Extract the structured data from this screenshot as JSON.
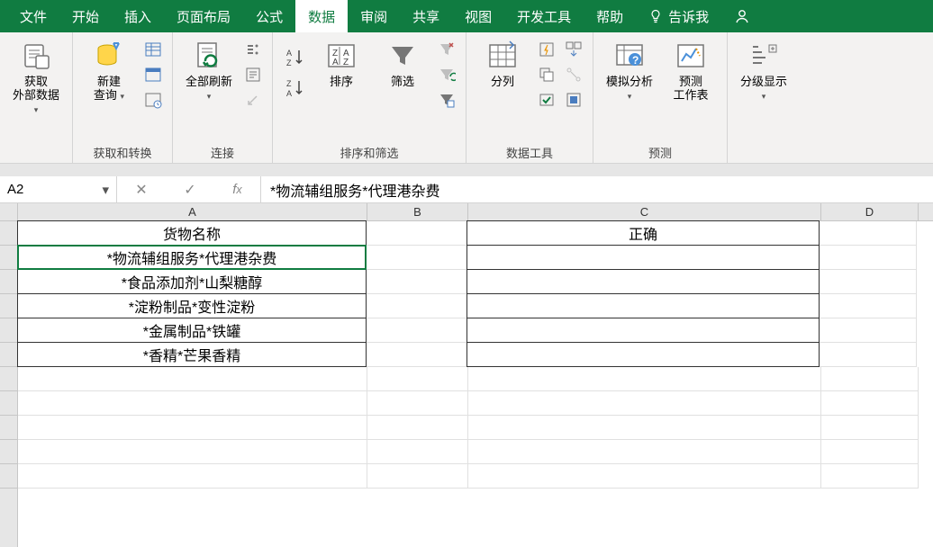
{
  "tabs": {
    "file": "文件",
    "home": "开始",
    "insert": "插入",
    "layout": "页面布局",
    "formula": "公式",
    "data": "数据",
    "review": "审阅",
    "share": "共享",
    "view": "视图",
    "dev": "开发工具",
    "help": "帮助",
    "tellme": "告诉我"
  },
  "ribbon": {
    "getdata": {
      "label": "获取\n外部数据",
      "group": ""
    },
    "newquery": "新建\n查询",
    "group_transform": "获取和转换",
    "refresh": "全部刷新",
    "group_connect": "连接",
    "sort": "排序",
    "filter": "筛选",
    "group_sortfilter": "排序和筛选",
    "texttocol": "分列",
    "group_datatools": "数据工具",
    "whatif": "模拟分析",
    "forecast": "预测\n工作表",
    "group_forecast": "预测",
    "outline": "分级显示"
  },
  "namebox": "A2",
  "formula": "*物流辅组服务*代理港杂费",
  "columns": [
    "A",
    "B",
    "C",
    "D"
  ],
  "sheet": {
    "A1": "货物名称",
    "A2": "*物流辅组服务*代理港杂费",
    "A3": "*食品添加剂*山梨糖醇",
    "A4": "*淀粉制品*变性淀粉",
    "A5": "*金属制品*铁罐",
    "A6": "*香精*芒果香精",
    "C1": "正确"
  }
}
